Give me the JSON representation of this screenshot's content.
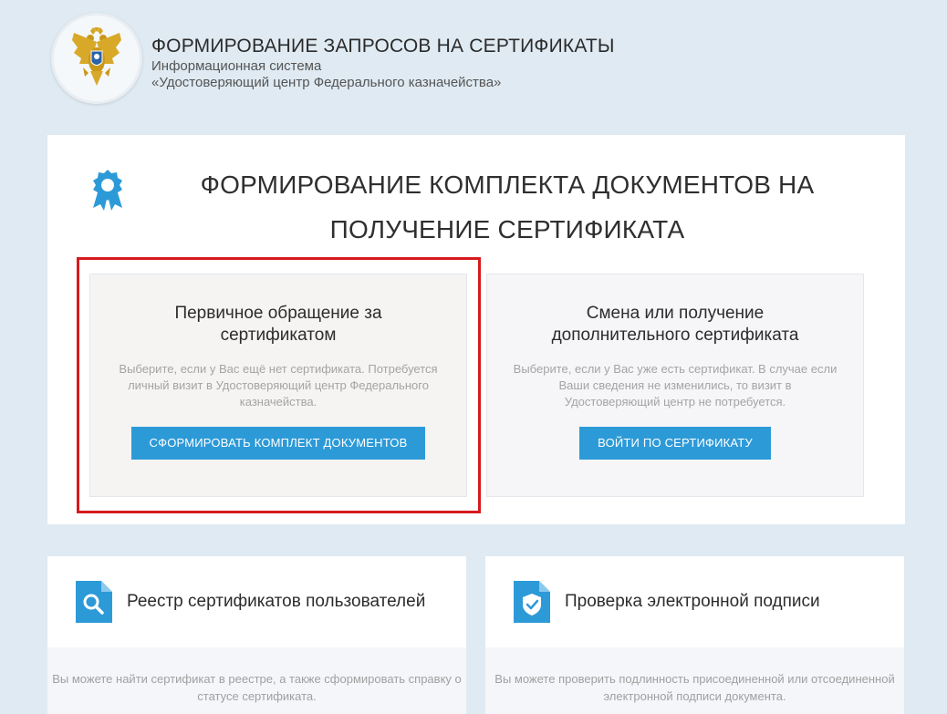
{
  "header": {
    "title": "ФОРМИРОВАНИЕ ЗАПРОСОВ НА СЕРТИФИКАТЫ",
    "subtitle1": "Информационная система",
    "subtitle2": "«Удостоверяющий центр Федерального казначейства»",
    "emblem_icon": "eagle-emblem-icon"
  },
  "main": {
    "title": "ФОРМИРОВАНИЕ КОМПЛЕКТА ДОКУМЕНТОВ НА ПОЛУЧЕНИЕ СЕРТИФИКАТА",
    "icon": "ribbon-badge-icon",
    "options": [
      {
        "title": "Первичное обращение за сертификатом",
        "description": "Выберите, если у Вас ещё нет сертификата. Потребуется личный визит в Удостоверяющий центр Федерального казначейства.",
        "button": "СФОРМИРОВАТЬ КОМПЛЕКТ ДОКУМЕНТОВ"
      },
      {
        "title": "Смена или получение дополнительного сертификата",
        "description": "Выберите, если у Вас уже есть сертификат. В случае если Ваши сведения не изменились, то визит в Удостоверяющий центр не потребуется.",
        "button": "ВОЙТИ ПО СЕРТИФИКАТУ"
      }
    ]
  },
  "cards": [
    {
      "title": "Реестр сертификатов пользователей",
      "icon": "document-search-icon",
      "description": "Вы можете найти сертификат в реестре, а также сформировать справку о статусе сертификата."
    },
    {
      "title": "Проверка электронной подписи",
      "icon": "document-shield-icon",
      "description": "Вы можете проверить подлинность присоединенной или отсоединенной электронной подписи документа."
    }
  ],
  "colors": {
    "accent": "#2d9ad8",
    "highlight": "#d61a1f",
    "background": "#dfeaf2"
  }
}
